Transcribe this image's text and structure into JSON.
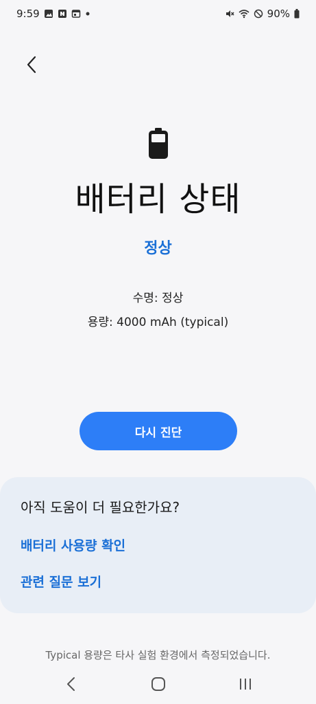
{
  "status_bar": {
    "time": "9:59",
    "battery_percent": "90%",
    "left_icons": [
      "gallery-icon",
      "naver-icon",
      "calendar-icon",
      "dot-icon"
    ],
    "right_icons": [
      "mute-icon",
      "wifi-icon",
      "dnd-icon",
      "battery-icon"
    ]
  },
  "header": {
    "back_icon": "chevron-left-icon"
  },
  "battery": {
    "icon": "battery-icon",
    "title": "배터리 상태",
    "status": "정상",
    "life_label": "수명: 정상",
    "capacity_label": "용량: 4000 mAh (typical)"
  },
  "actions": {
    "rediagnose_label": "다시 진단"
  },
  "help": {
    "title": "아직 도움이 더 필요한가요?",
    "link_usage": "배터리 사용량 확인",
    "link_faq": "관련 질문 보기"
  },
  "footnote": "Typical 용량은 타사 실험 환경에서 측정되었습니다.",
  "nav_bar": {
    "back": "back-nav-icon",
    "home": "home-nav-icon",
    "recents": "recents-nav-icon"
  },
  "colors": {
    "accent": "#1a6fd6",
    "button": "#2d7ef7",
    "card": "#e8eef6",
    "background": "#f6f6f8"
  }
}
